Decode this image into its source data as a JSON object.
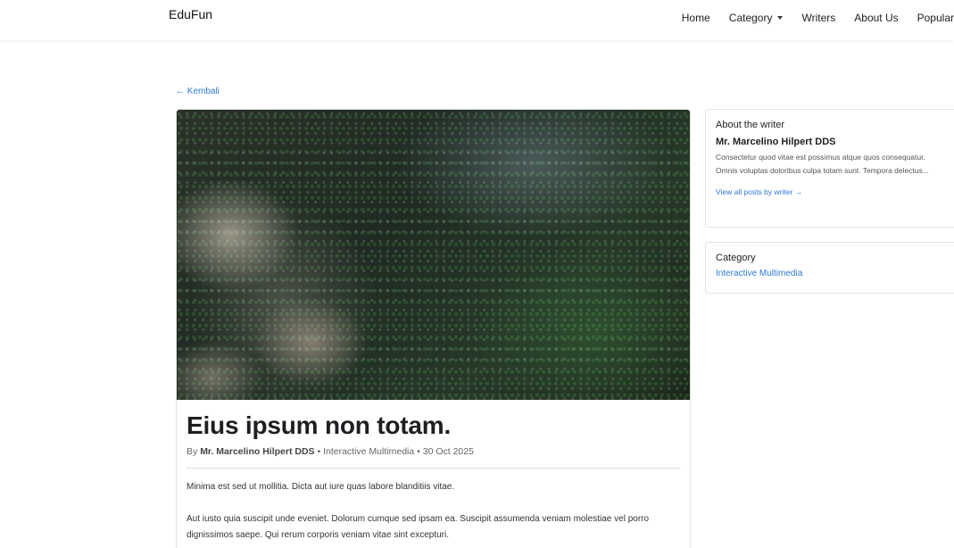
{
  "navbar": {
    "brand": "EduFun",
    "links": [
      {
        "label": "Home"
      },
      {
        "label": "Category"
      },
      {
        "label": "Writers"
      },
      {
        "label": "About Us"
      },
      {
        "label": "Popular"
      }
    ]
  },
  "back_link": "← Kembali",
  "article": {
    "title": "Eius ipsum non totam.",
    "by_prefix": "By",
    "author": "Mr. Marcelino Hilpert DDS",
    "separator": "•",
    "category": "Interactive Multimedia",
    "date": "30 Oct 2025",
    "paragraphs": [
      "Minima est sed ut mollitia. Dicta aut iure quas labore blanditiis vitae.",
      "Aut iusto quia suscipit unde eveniet. Dolorum cumque sed ipsam ea. Suscipit assumenda veniam molestiae vel porro dignissimos saepe. Qui rerum corporis veniam vitae sint excepturi."
    ]
  },
  "sidebar": {
    "about": {
      "heading": "About the writer",
      "writer_name": "Mr. Marcelino Hilpert DDS",
      "bio": "Consectetur quod vitae est possimus atque quos consequatur. Omnis voluptas doloribus culpa totam sunt. Tempora delectus...",
      "link": "View all posts by writer →"
    },
    "category": {
      "heading": "Category",
      "link": "Interactive Multimedia"
    }
  }
}
